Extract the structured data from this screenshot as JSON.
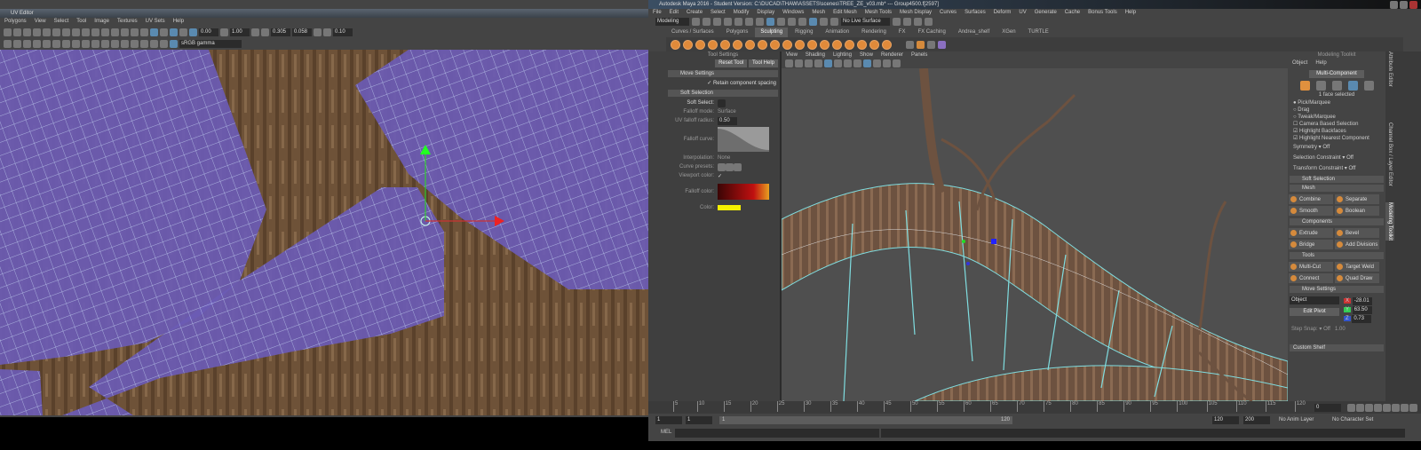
{
  "uv_editor": {
    "title": "UV Editor",
    "menu": [
      "Polygons",
      "View",
      "Select",
      "Tool",
      "Image",
      "Textures",
      "UV Sets",
      "Help"
    ],
    "fields": {
      "exposure": "0.00",
      "gamma": "1.00",
      "color_space": "sRGB gamma",
      "u": "0.305",
      "v": "0.058",
      "step": "0.10"
    }
  },
  "maya": {
    "title": "Autodesk Maya 2016 - Student Version: C:\\DUCAD\\THAW\\ASSETS\\scenes\\TREE_ZE_v03.mb* --- Group4500.f[2597]",
    "menu": [
      "File",
      "Edit",
      "Create",
      "Select",
      "Modify",
      "Display",
      "Windows",
      "Mesh",
      "Edit Mesh",
      "Mesh Tools",
      "Mesh Display",
      "Curves",
      "Surfaces",
      "Deform",
      "UV",
      "Generate",
      "Cache",
      "Bonus Tools",
      "Help"
    ],
    "mode": "Modeling",
    "live_surface": "No Live Surface",
    "shelf_tabs": [
      "Curves / Surfaces",
      "Polygons",
      "Sculpting",
      "Rigging",
      "Animation",
      "Rendering",
      "FX",
      "FX Caching",
      "Andrea_shelf",
      "XGen",
      "TURTLE"
    ],
    "active_shelf": "Sculpting",
    "tool_settings": {
      "header": "Tool Settings",
      "reset": "Reset Tool",
      "help": "Tool Help",
      "move_settings": "Move Settings",
      "retain": "Retain component spacing",
      "soft_selection": "Soft Selection",
      "soft_select": "Soft Select:",
      "falloff_mode_label": "Falloff mode:",
      "falloff_mode": "Surface",
      "uv_radius_label": "UV falloff radius:",
      "uv_radius": "0.50",
      "falloff_curve": "Falloff curve:",
      "interpolation_label": "Interpolation:",
      "interpolation": "None",
      "curve_presets": "Curve presets:",
      "viewport_color": "Viewport color:",
      "falloff_color": "Falloff color:",
      "color": "Color:"
    },
    "viewport_menu": [
      "View",
      "Shading",
      "Lighting",
      "Show",
      "Renderer",
      "Panels"
    ],
    "toolkit": {
      "header": "Modeling Toolkit",
      "menu": [
        "Object",
        "Help"
      ],
      "multi": "Multi-Component",
      "selected": "1 face selected",
      "modes": [
        "Pick/Marquee",
        "Drag",
        "Tweak/Marquee"
      ],
      "checks": [
        "Camera Based Selection",
        "Highlight Backfaces",
        "Highlight Nearest Component"
      ],
      "symmetry": "Symmetry",
      "symmetry_val": "Off",
      "sel_constraint": "Selection Constraint",
      "sel_val": "Off",
      "trans_constraint": "Transform Constraint",
      "trans_val": "Off",
      "soft_sel": "Soft Selection",
      "mesh": "Mesh",
      "mesh_tools": [
        "Combine",
        "Separate",
        "Smooth",
        "Boolean"
      ],
      "components": "Components",
      "comp_tools": [
        "Extrude",
        "Bevel",
        "Bridge",
        "Add Divisions"
      ],
      "tools": "Tools",
      "tool_tools": [
        "Multi-Cut",
        "Target Weld",
        "Connect",
        "Quad Draw"
      ],
      "move": "Move Settings",
      "object": "Object",
      "edit_pivot": "Edit Pivot",
      "x": "-28.01",
      "y": "63.50",
      "z": "0.73",
      "step_snap": "Step Snap:",
      "step_val": "Off",
      "step_num": "1.00",
      "custom_shelf": "Custom Shelf"
    },
    "side_tabs": [
      "Attribute Editor",
      "Channel Box / Layer Editor",
      "Modeling Toolkit"
    ],
    "timeline": {
      "ticks": [
        "5",
        "10",
        "15",
        "20",
        "25",
        "30",
        "35",
        "40",
        "45",
        "50",
        "55",
        "60",
        "65",
        "70",
        "75",
        "80",
        "85",
        "90",
        "95",
        "100",
        "105",
        "110",
        "115",
        "120"
      ],
      "current": "0"
    },
    "range": {
      "start": "1",
      "start2": "1",
      "slider_start": "1",
      "slider_end": "120",
      "end": "120",
      "end2": "200",
      "anim_layer": "No Anim Layer",
      "char_set": "No Character Set"
    },
    "mel": "MEL"
  }
}
